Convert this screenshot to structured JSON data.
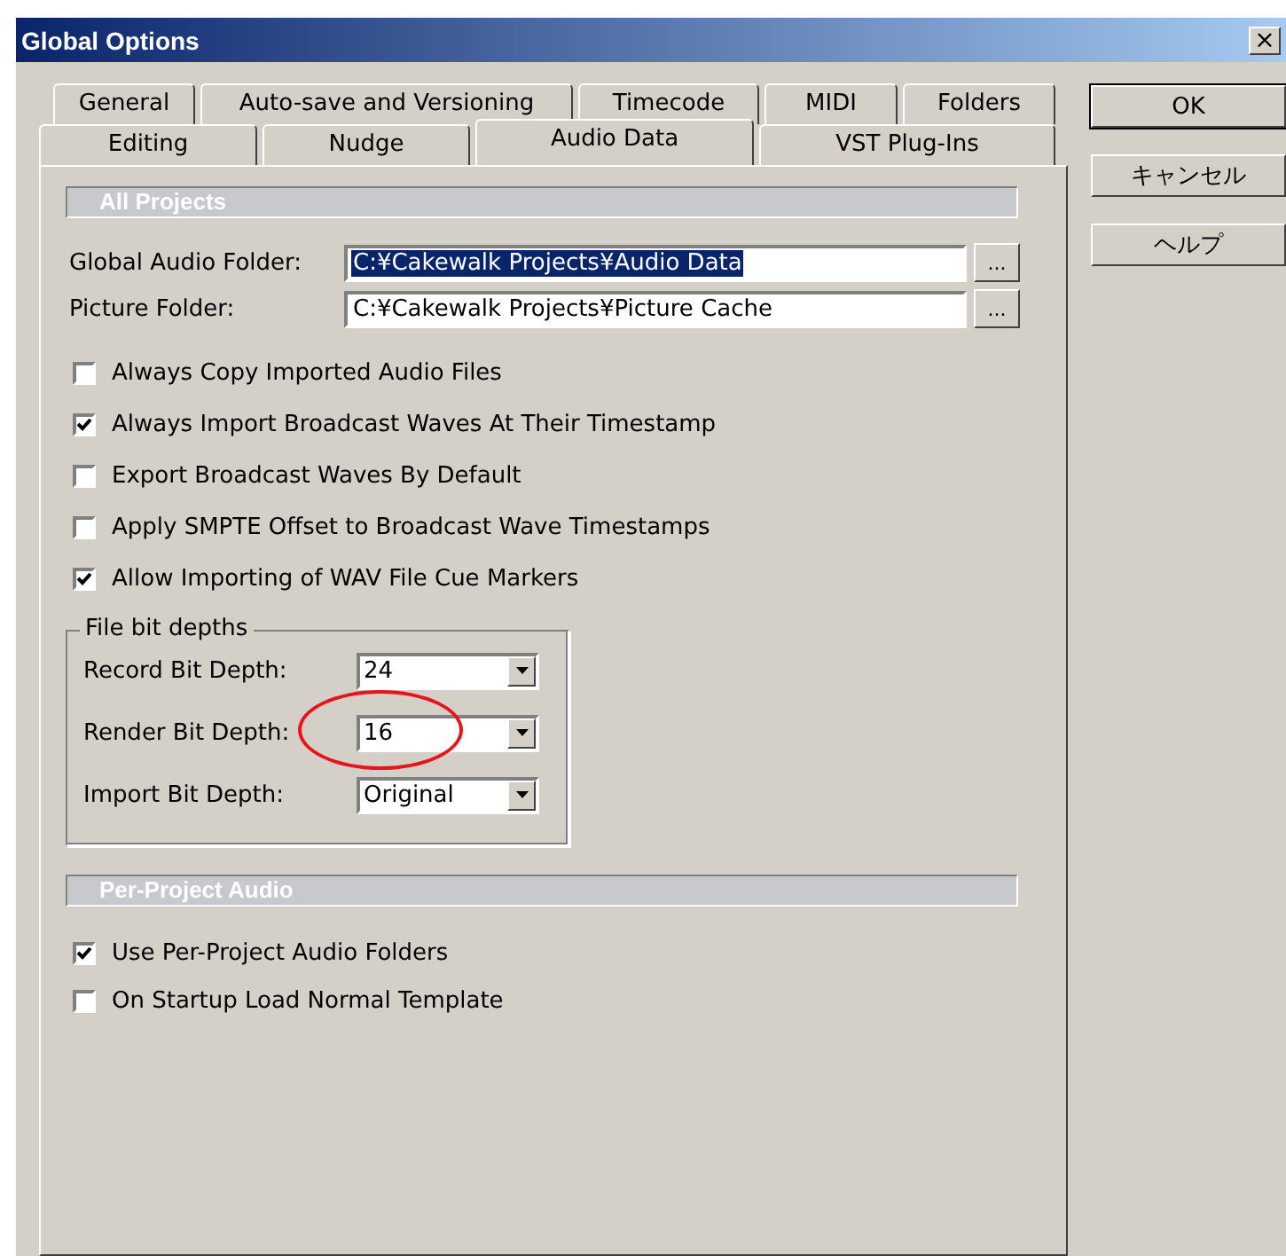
{
  "window": {
    "title": "Global Options",
    "close": "×"
  },
  "tabs": [
    [
      {
        "label": "General",
        "selected": false
      },
      {
        "label": "Auto-save and Versioning",
        "selected": false
      },
      {
        "label": "Timecode",
        "selected": false
      },
      {
        "label": "MIDI",
        "selected": false
      },
      {
        "label": "Folders",
        "selected": false
      }
    ],
    [
      {
        "label": "Editing",
        "selected": false
      },
      {
        "label": "Nudge",
        "selected": false
      },
      {
        "label": "Audio Data",
        "selected": true
      },
      {
        "label": "VST Plug-Ins",
        "selected": false
      }
    ]
  ],
  "all_projects": {
    "heading": "All Projects",
    "folders": [
      {
        "label": "Global Audio Folder:",
        "value": "C:¥Cakewalk Projects¥Audio Data",
        "selected": true,
        "browse": "..."
      },
      {
        "label": "Picture Folder:",
        "value": "C:¥Cakewalk Projects¥Picture Cache",
        "selected": false,
        "browse": "..."
      }
    ],
    "options": [
      {
        "label": "Always Copy Imported Audio Files",
        "checked": false
      },
      {
        "label": "Always Import Broadcast Waves At Their Timestamp",
        "checked": true
      },
      {
        "label": "Export Broadcast Waves By Default",
        "checked": false
      },
      {
        "label": "Apply SMPTE Offset to Broadcast Wave Timestamps",
        "checked": false
      },
      {
        "label": "Allow Importing of WAV File Cue Markers",
        "checked": true
      }
    ]
  },
  "bit_depths": {
    "title": "File bit depths",
    "rows": [
      {
        "label": "Record Bit Depth:",
        "value": "24",
        "highlighted": false
      },
      {
        "label": "Render Bit Depth:",
        "value": "16",
        "highlighted": true
      },
      {
        "label": "Import Bit Depth:",
        "value": "Original",
        "highlighted": false
      }
    ]
  },
  "per_project": {
    "heading": "Per-Project Audio",
    "options": [
      {
        "label": "Use Per-Project Audio Folders",
        "checked": true
      },
      {
        "label": "On Startup Load Normal Template",
        "checked": false
      }
    ]
  },
  "buttons": [
    "OK",
    "キャンセル",
    "ヘルプ"
  ]
}
